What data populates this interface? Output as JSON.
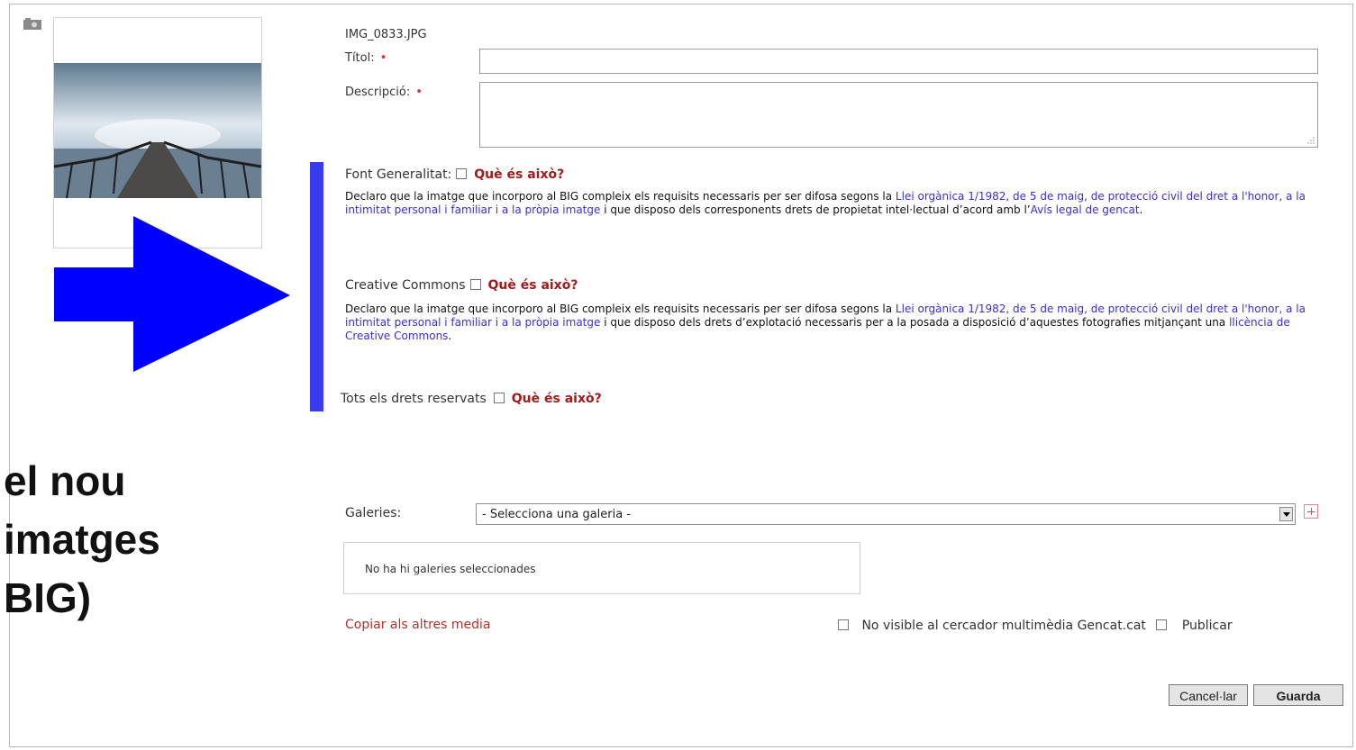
{
  "file": {
    "name": "IMG_0833.JPG"
  },
  "form": {
    "title_label": "Títol:",
    "title_value": "",
    "description_label": "Descripció:",
    "description_value": "",
    "required_mark": "•"
  },
  "licenses": {
    "what_is_this": "Què és això?",
    "font_generalitat": {
      "label": "Font Generalitat:",
      "text_1": "Declaro que la imatge que incorporo al BIG compleix els requisits necessaris per ser difosa segons la ",
      "link_1": "Llei orgànica 1/1982, de 5 de maig, de protecció civil del dret a l'honor, a la intimitat personal i familiar i a la pròpia imatge",
      "text_2": " i que disposo dels corresponents drets de propietat intel·lectual d’acord amb l’",
      "link_2": "Avís legal de gencat",
      "text_3": "."
    },
    "creative_commons": {
      "label": "Creative Commons",
      "text_1": "Declaro que la imatge que incorporo al BIG compleix els requisits necessaris per ser difosa segons la ",
      "link_1": "Llei orgànica 1/1982, de 5 de maig, de protecció civil del dret a l'honor, a la intimitat personal i familiar i a la pròpia imatge",
      "text_2": " i que disposo dels drets d’explotació necessaris per a la posada a disposició d’aquestes fotografies mitjançant una ",
      "link_2": "llicència de Creative Commons",
      "text_3": "."
    },
    "all_rights": {
      "label": "Tots els drets reservats"
    }
  },
  "galleries": {
    "label": "Galeries:",
    "select_value": "- Selecciona una galeria -",
    "empty_text": "No ha hi galeries seleccionades"
  },
  "footer": {
    "copy_link": "Copiar als altres media",
    "not_visible_label": "No visible al cercador multimèdia Gencat.cat",
    "publish_label": "Publicar",
    "cancel_label": "Cancel·lar",
    "save_label": "Guarda"
  },
  "overlay": {
    "line_1": "el nou",
    "line_2": "imatges",
    "line_3": "BIG)"
  },
  "colors": {
    "arrow": "#0000ff",
    "bar": "#3a3af0",
    "link": "#3a2ed6",
    "what_is_this": "#a31a1a"
  }
}
